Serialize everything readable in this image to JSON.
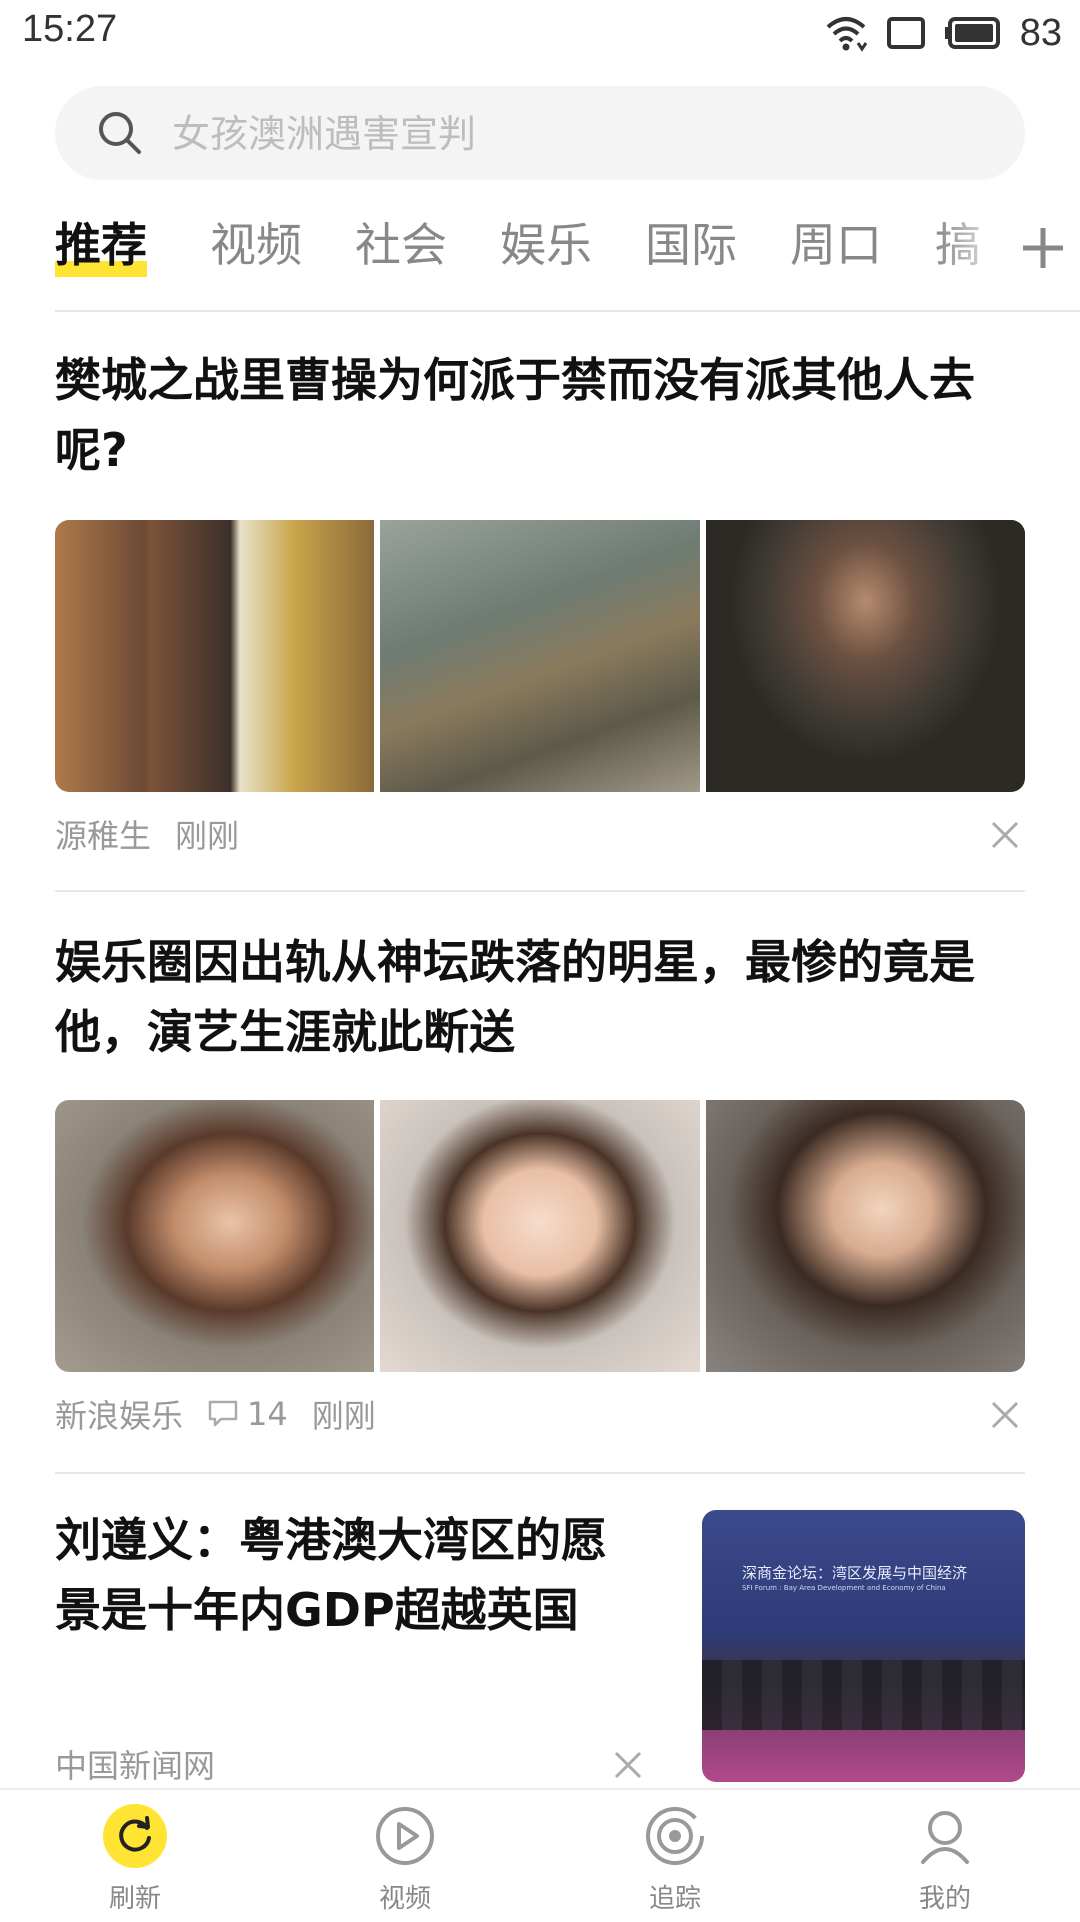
{
  "status": {
    "time": "15:27",
    "battery": "83"
  },
  "search": {
    "placeholder": "女孩澳洲遇害宣判"
  },
  "tabs": [
    {
      "label": "推荐",
      "active": true
    },
    {
      "label": "视频"
    },
    {
      "label": "社会"
    },
    {
      "label": "娱乐"
    },
    {
      "label": "国际"
    },
    {
      "label": "周口"
    },
    {
      "label": "搞"
    }
  ],
  "articles": [
    {
      "title_line1": "樊城之战里曹操为何派于禁而没有派其他人去",
      "title_line2": "呢?",
      "source": "源稚生",
      "time": "刚刚"
    },
    {
      "title_line1": "娱乐圈因出轨从神坛跌落的明星，最惨的竟是",
      "title_line2": "他，演艺生涯就此断送",
      "source": "新浪娱乐",
      "comments": "14",
      "time": "刚刚"
    },
    {
      "title_line1": "刘遵义：粤港澳大湾区的愿",
      "title_line2": "景是十年内GDP超越英国",
      "source": "中国新闻网",
      "image_caption_line1": "深商金论坛：湾区发展与中国经济",
      "image_caption_line2": "SFI Forum : Bay Area Development and Economy of China"
    }
  ],
  "nav": [
    {
      "label": "刷新",
      "icon": "refresh-icon",
      "active": true
    },
    {
      "label": "视频",
      "icon": "play-icon"
    },
    {
      "label": "追踪",
      "icon": "track-icon"
    },
    {
      "label": "我的",
      "icon": "profile-icon"
    }
  ],
  "colors": {
    "accent": "#FFE433",
    "text_muted": "#999999"
  }
}
